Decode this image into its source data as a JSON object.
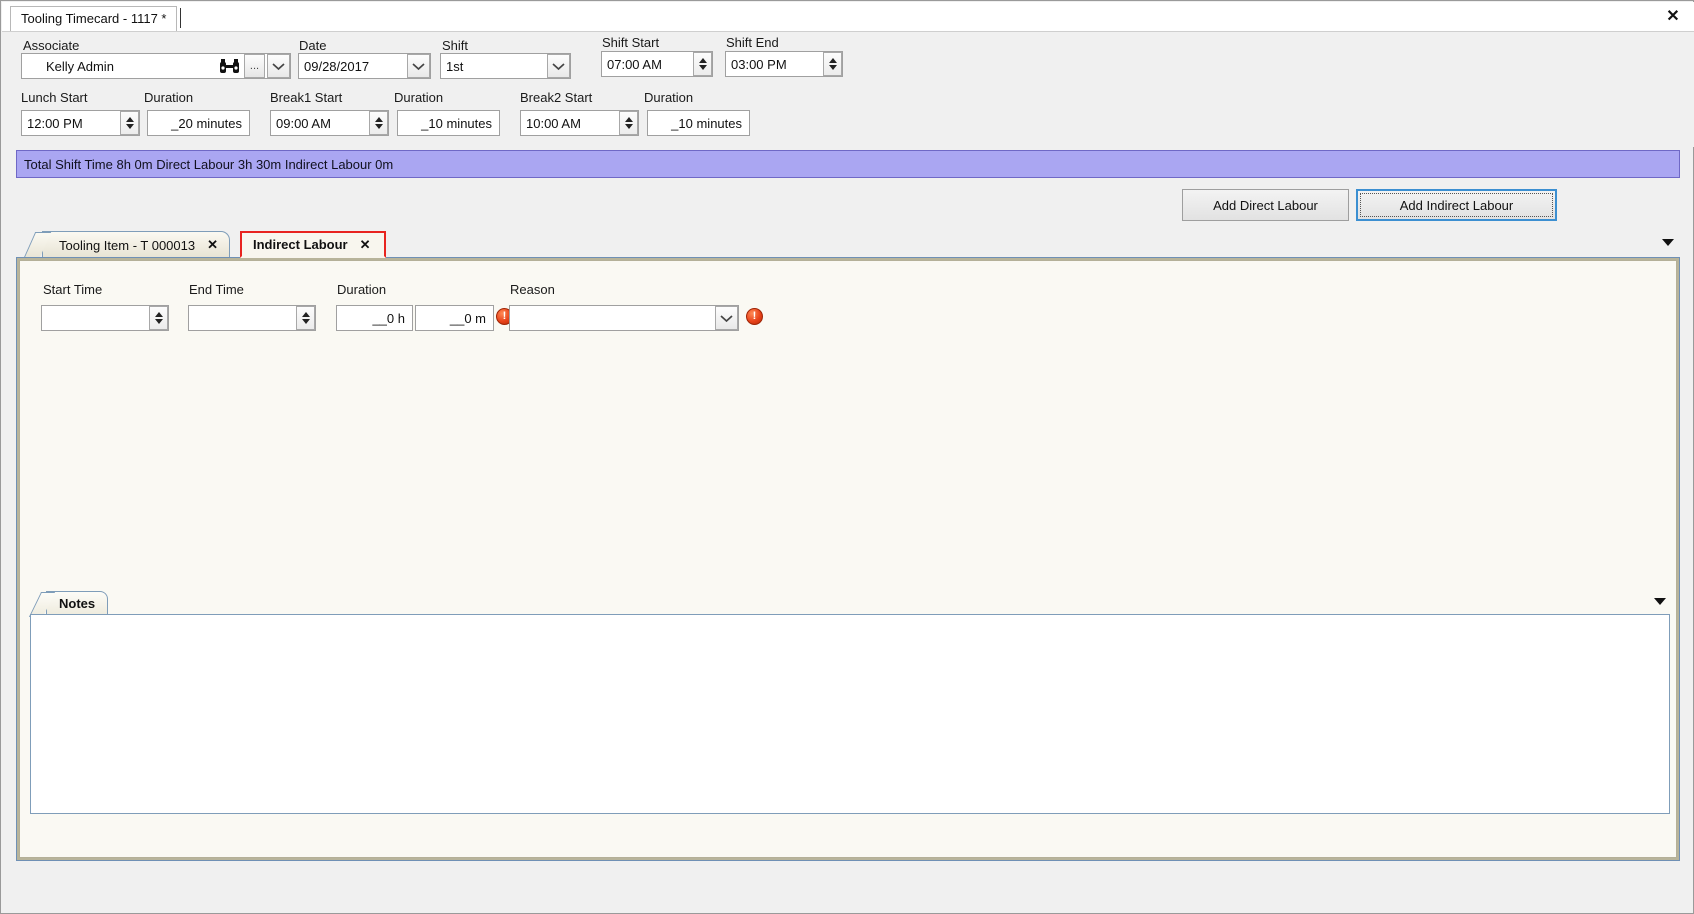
{
  "window": {
    "doc_tab_title": "Tooling Timecard - 1117 *",
    "close_label": "✕"
  },
  "header": {
    "associate": {
      "label": "Associate",
      "value": "Kelly Admin",
      "search_icon": "binoculars-icon",
      "ellipsis_label": "...",
      "dropdown_icon": "chevron-down-icon"
    },
    "date": {
      "label": "Date",
      "value": "09/28/2017"
    },
    "shift": {
      "label": "Shift",
      "value": "1st"
    },
    "shift_start": {
      "label": "Shift Start",
      "value": "07:00 AM"
    },
    "shift_end": {
      "label": "Shift End",
      "value": "03:00 PM"
    },
    "lunch_start": {
      "label": "Lunch Start",
      "value": "12:00 PM"
    },
    "lunch_duration": {
      "label": "Duration",
      "value": "_20 minutes"
    },
    "break1_start": {
      "label": "Break1 Start",
      "value": "09:00 AM"
    },
    "break1_duration": {
      "label": "Duration",
      "value": "_10 minutes"
    },
    "break2_start": {
      "label": "Break2 Start",
      "value": "10:00 AM"
    },
    "break2_duration": {
      "label": "Duration",
      "value": "_10 minutes"
    }
  },
  "summary": {
    "text": "Total Shift Time 8h 0m  Direct Labour 3h 30m  Indirect Labour 0m",
    "background_color": "#aaa6f2"
  },
  "actions": {
    "add_direct_label": "Add Direct Labour",
    "add_indirect_label": "Add Indirect Labour",
    "focus_color": "#3c8fd1"
  },
  "tabs": {
    "items": [
      {
        "label": "Tooling Item - T 000013",
        "close": "✕",
        "active": false
      },
      {
        "label": "Indirect Labour",
        "close": "✕",
        "active": true
      }
    ],
    "overflow_icon": "chevron-down-icon",
    "active_highlight_color": "#e8241f"
  },
  "indirect_form": {
    "start_time": {
      "label": "Start Time",
      "value": ""
    },
    "end_time": {
      "label": "End Time",
      "value": ""
    },
    "duration": {
      "label": "Duration",
      "hours_value": "__0 h",
      "minutes_value": "__0 m",
      "hours_error_icon": "error-icon",
      "minutes_error_icon": "error-icon"
    },
    "reason": {
      "label": "Reason",
      "value": "",
      "dropdown_icon": "chevron-down-icon",
      "error_icon": "error-icon"
    },
    "error_color": "#e8431a"
  },
  "notes": {
    "tab_label": "Notes",
    "value": "",
    "overflow_icon": "chevron-down-icon"
  }
}
